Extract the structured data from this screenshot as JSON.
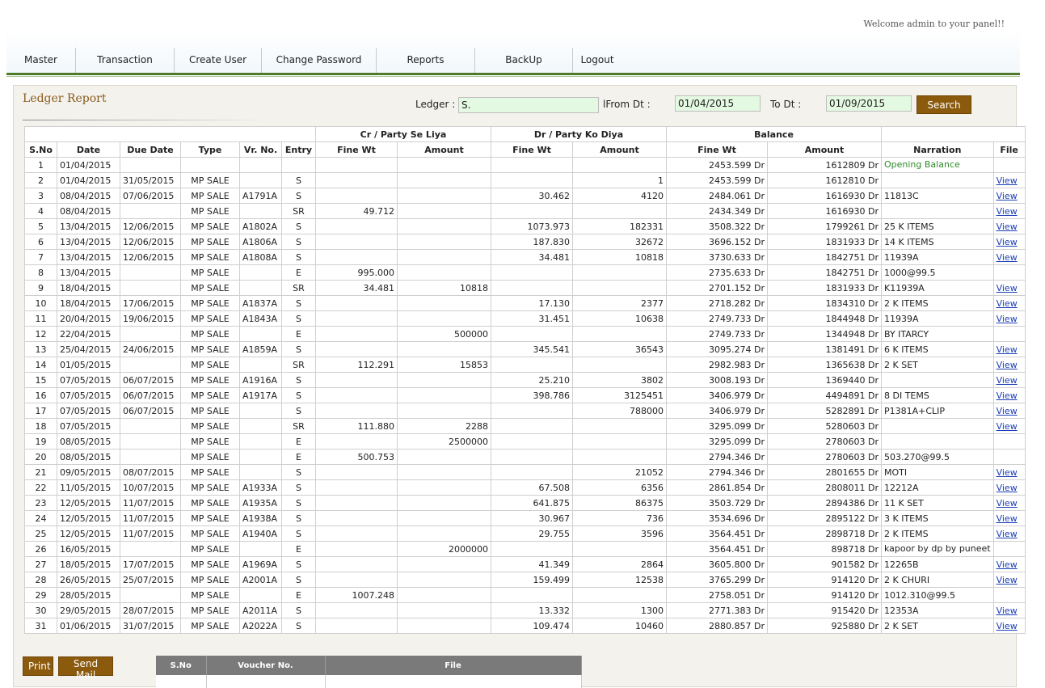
{
  "header": {
    "welcome": "Welcome admin to your panel!!"
  },
  "nav": {
    "items": [
      {
        "label": "Master",
        "w": 85
      },
      {
        "label": "Transaction",
        "w": 121
      },
      {
        "label": "Create User",
        "w": 107
      },
      {
        "label": "Change Password",
        "w": 141
      },
      {
        "label": "Reports",
        "w": 121
      },
      {
        "label": "BackUp",
        "w": 120
      },
      {
        "label": "Logout",
        "w": 60
      }
    ]
  },
  "report": {
    "title": "Ledger Report",
    "ledger_label": "Ledger :",
    "ledger_value": "S.",
    "from_label": "lFrom Dt :",
    "from_value": "01/04/2015",
    "to_label": "To Dt :",
    "to_value": "01/09/2015",
    "search_label": "Search"
  },
  "table": {
    "group_headers": {
      "cr": "Cr / Party Se Liya",
      "dr": "Dr / Party Ko Diya",
      "balance": "Balance"
    },
    "columns": [
      "S.No",
      "Date",
      "Due Date",
      "Type",
      "Vr. No.",
      "Entry",
      "Fine Wt",
      "Amount",
      "Fine Wt",
      "Amount",
      "Fine Wt",
      "Amount",
      "Narration",
      "File"
    ],
    "view_label": "View",
    "rows": [
      [
        "1",
        "01/04/2015",
        "",
        "",
        "",
        "",
        "",
        "",
        "",
        "",
        "2453.599 Dr",
        "1612809 Dr",
        "Opening Balance",
        ""
      ],
      [
        "2",
        "01/04/2015",
        "31/05/2015",
        "MP SALE",
        "",
        "S",
        "",
        "",
        "",
        "1",
        "2453.599 Dr",
        "1612810 Dr",
        "",
        "View"
      ],
      [
        "3",
        "08/04/2015",
        "07/06/2015",
        "MP SALE",
        "A1791A",
        "S",
        "",
        "",
        "30.462",
        "4120",
        "2484.061 Dr",
        "1616930 Dr",
        "11813C",
        "View"
      ],
      [
        "4",
        "08/04/2015",
        "",
        "MP SALE",
        "",
        "SR",
        "49.712",
        "",
        "",
        "",
        "2434.349 Dr",
        "1616930 Dr",
        "",
        "View"
      ],
      [
        "5",
        "13/04/2015",
        "12/06/2015",
        "MP SALE",
        "A1802A",
        "S",
        "",
        "",
        "1073.973",
        "182331",
        "3508.322 Dr",
        "1799261 Dr",
        "25 K ITEMS",
        "View"
      ],
      [
        "6",
        "13/04/2015",
        "12/06/2015",
        "MP SALE",
        "A1806A",
        "S",
        "",
        "",
        "187.830",
        "32672",
        "3696.152 Dr",
        "1831933 Dr",
        "14 K ITEMS",
        "View"
      ],
      [
        "7",
        "13/04/2015",
        "12/06/2015",
        "MP SALE",
        "A1808A",
        "S",
        "",
        "",
        "34.481",
        "10818",
        "3730.633 Dr",
        "1842751 Dr",
        "11939A",
        "View"
      ],
      [
        "8",
        "13/04/2015",
        "",
        "MP SALE",
        "",
        "E",
        "995.000",
        "",
        "",
        "",
        "2735.633 Dr",
        "1842751 Dr",
        "1000@99.5",
        ""
      ],
      [
        "9",
        "18/04/2015",
        "",
        "MP SALE",
        "",
        "SR",
        "34.481",
        "10818",
        "",
        "",
        "2701.152 Dr",
        "1831933 Dr",
        "K11939A",
        "View"
      ],
      [
        "10",
        "18/04/2015",
        "17/06/2015",
        "MP SALE",
        "A1837A",
        "S",
        "",
        "",
        "17.130",
        "2377",
        "2718.282 Dr",
        "1834310 Dr",
        "2 K ITEMS",
        "View"
      ],
      [
        "11",
        "20/04/2015",
        "19/06/2015",
        "MP SALE",
        "A1843A",
        "S",
        "",
        "",
        "31.451",
        "10638",
        "2749.733 Dr",
        "1844948 Dr",
        "11939A",
        "View"
      ],
      [
        "12",
        "22/04/2015",
        "",
        "MP SALE",
        "",
        "E",
        "",
        "500000",
        "",
        "",
        "2749.733 Dr",
        "1344948 Dr",
        "BY ITARCY",
        ""
      ],
      [
        "13",
        "25/04/2015",
        "24/06/2015",
        "MP SALE",
        "A1859A",
        "S",
        "",
        "",
        "345.541",
        "36543",
        "3095.274 Dr",
        "1381491 Dr",
        "6 K ITEMS",
        "View"
      ],
      [
        "14",
        "01/05/2015",
        "",
        "MP SALE",
        "",
        "SR",
        "112.291",
        "15853",
        "",
        "",
        "2982.983 Dr",
        "1365638 Dr",
        "2 K SET",
        "View"
      ],
      [
        "15",
        "07/05/2015",
        "06/07/2015",
        "MP SALE",
        "A1916A",
        "S",
        "",
        "",
        "25.210",
        "3802",
        "3008.193 Dr",
        "1369440 Dr",
        "",
        "View"
      ],
      [
        "16",
        "07/05/2015",
        "06/07/2015",
        "MP SALE",
        "A1917A",
        "S",
        "",
        "",
        "398.786",
        "3125451",
        "3406.979 Dr",
        "4494891 Dr",
        "8 DI TEMS",
        "View"
      ],
      [
        "17",
        "07/05/2015",
        "06/07/2015",
        "MP SALE",
        "",
        "S",
        "",
        "",
        "",
        "788000",
        "3406.979 Dr",
        "5282891 Dr",
        "P1381A+CLIP",
        "View"
      ],
      [
        "18",
        "07/05/2015",
        "",
        "MP SALE",
        "",
        "SR",
        "111.880",
        "2288",
        "",
        "",
        "3295.099 Dr",
        "5280603 Dr",
        "",
        "View"
      ],
      [
        "19",
        "08/05/2015",
        "",
        "MP SALE",
        "",
        "E",
        "",
        "2500000",
        "",
        "",
        "3295.099 Dr",
        "2780603 Dr",
        "",
        ""
      ],
      [
        "20",
        "08/05/2015",
        "",
        "MP SALE",
        "",
        "E",
        "500.753",
        "",
        "",
        "",
        "2794.346 Dr",
        "2780603 Dr",
        "503.270@99.5",
        ""
      ],
      [
        "21",
        "09/05/2015",
        "08/07/2015",
        "MP SALE",
        "",
        "S",
        "",
        "",
        "",
        "21052",
        "2794.346 Dr",
        "2801655 Dr",
        "MOTI",
        "View"
      ],
      [
        "22",
        "11/05/2015",
        "10/07/2015",
        "MP SALE",
        "A1933A",
        "S",
        "",
        "",
        "67.508",
        "6356",
        "2861.854 Dr",
        "2808011 Dr",
        "12212A",
        "View"
      ],
      [
        "23",
        "12/05/2015",
        "11/07/2015",
        "MP SALE",
        "A1935A",
        "S",
        "",
        "",
        "641.875",
        "86375",
        "3503.729 Dr",
        "2894386 Dr",
        "11 K SET",
        "View"
      ],
      [
        "24",
        "12/05/2015",
        "11/07/2015",
        "MP SALE",
        "A1938A",
        "S",
        "",
        "",
        "30.967",
        "736",
        "3534.696 Dr",
        "2895122 Dr",
        "3 K ITEMS",
        "View"
      ],
      [
        "25",
        "12/05/2015",
        "11/07/2015",
        "MP SALE",
        "A1940A",
        "S",
        "",
        "",
        "29.755",
        "3596",
        "3564.451 Dr",
        "2898718 Dr",
        "2 K ITEMS",
        "View"
      ],
      [
        "26",
        "16/05/2015",
        "",
        "MP SALE",
        "",
        "E",
        "",
        "2000000",
        "",
        "",
        "3564.451 Dr",
        "898718 Dr",
        "kapoor by dp by puneet",
        ""
      ],
      [
        "27",
        "18/05/2015",
        "17/07/2015",
        "MP SALE",
        "A1969A",
        "S",
        "",
        "",
        "41.349",
        "2864",
        "3605.800 Dr",
        "901582 Dr",
        "12265B",
        "View"
      ],
      [
        "28",
        "26/05/2015",
        "25/07/2015",
        "MP SALE",
        "A2001A",
        "S",
        "",
        "",
        "159.499",
        "12538",
        "3765.299 Dr",
        "914120 Dr",
        "2 K CHURI",
        "View"
      ],
      [
        "29",
        "28/05/2015",
        "",
        "MP SALE",
        "",
        "E",
        "1007.248",
        "",
        "",
        "",
        "2758.051 Dr",
        "914120 Dr",
        "1012.310@99.5",
        ""
      ],
      [
        "30",
        "29/05/2015",
        "28/07/2015",
        "MP SALE",
        "A2011A",
        "S",
        "",
        "",
        "13.332",
        "1300",
        "2771.383 Dr",
        "915420 Dr",
        "12353A",
        "View"
      ],
      [
        "31",
        "01/06/2015",
        "31/07/2015",
        "MP SALE",
        "A2022A",
        "S",
        "",
        "",
        "109.474",
        "10460",
        "2880.857 Dr",
        "925880 Dr",
        "2 K SET",
        "View"
      ]
    ]
  },
  "footer": {
    "print_label": "Print",
    "mail_label": "Send Mail",
    "files_columns": [
      "S.No",
      "Voucher No.",
      "File"
    ]
  }
}
